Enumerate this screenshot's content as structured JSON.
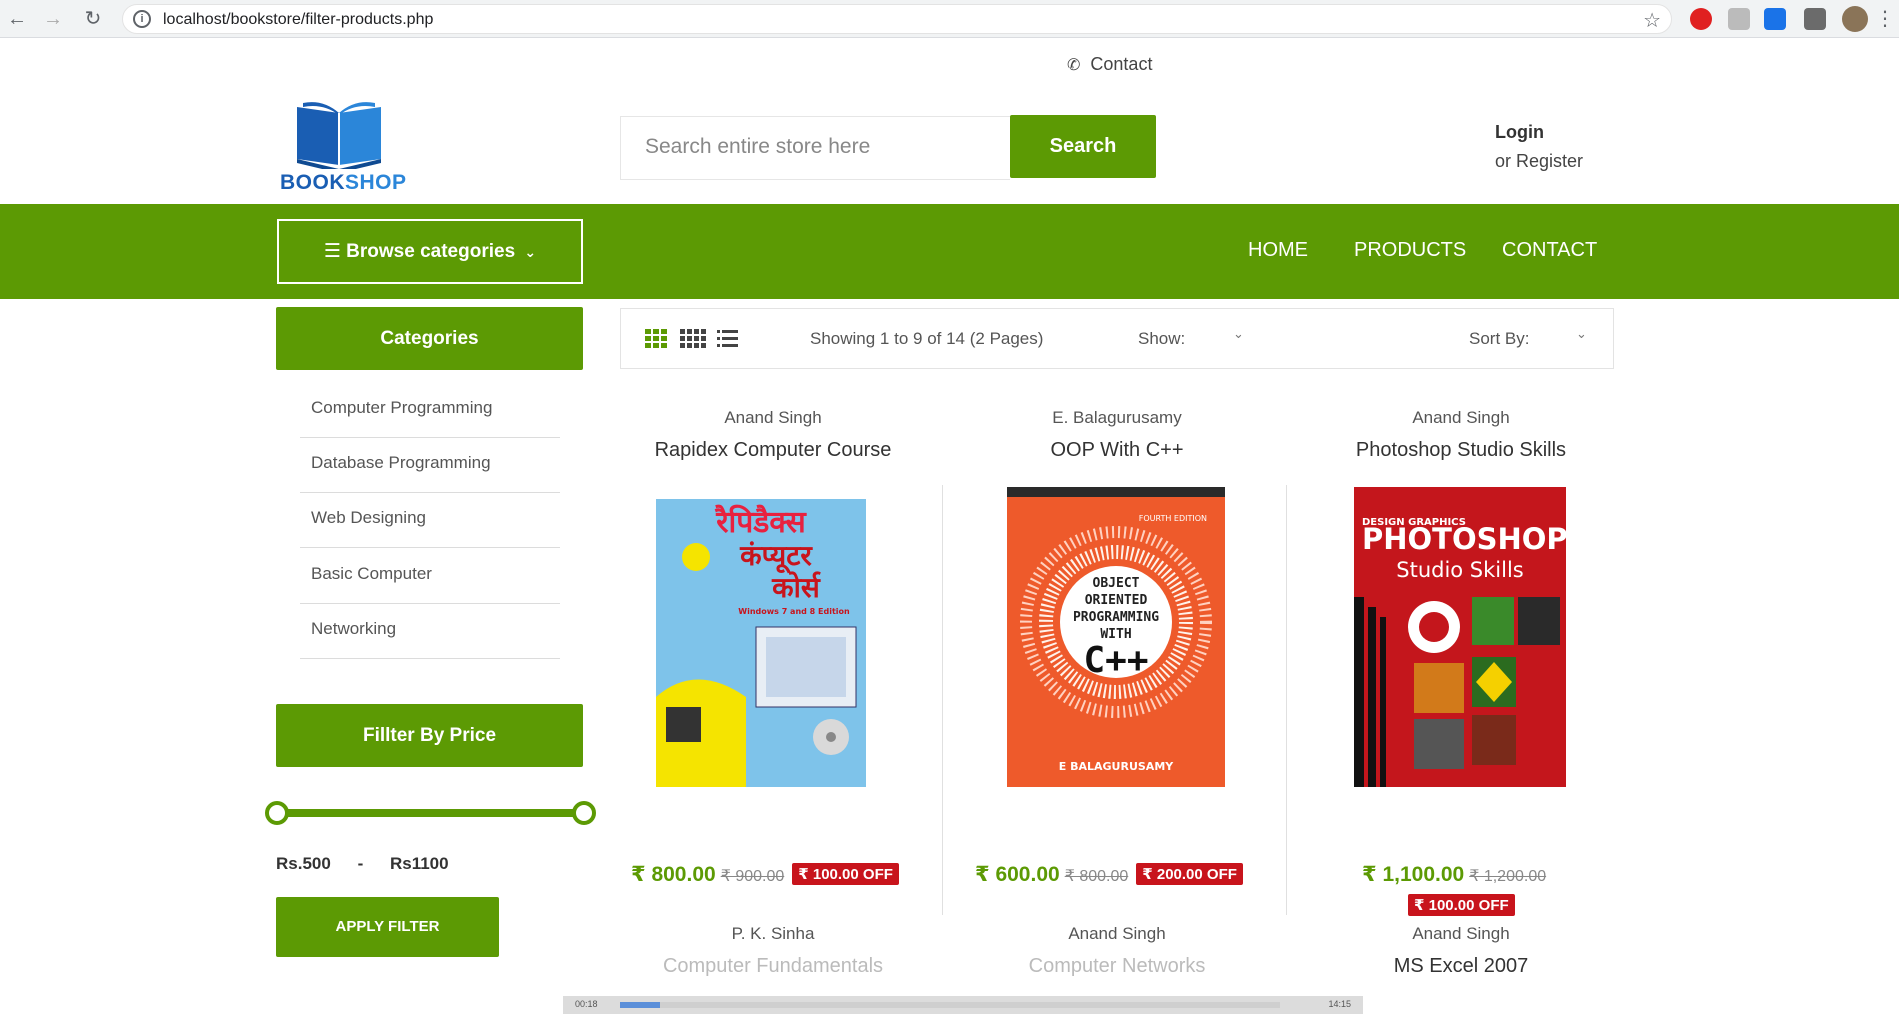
{
  "browser": {
    "url": "localhost/bookstore/filter-products.php"
  },
  "header": {
    "contact_label": "Contact",
    "logo_text_1": "BOOK",
    "logo_text_2": "SHOP",
    "search_placeholder": "Search entire store here",
    "search_button": "Search",
    "login_label": "Login",
    "register_label": "or Register"
  },
  "navbar": {
    "browse_label": "Browse categories",
    "menu": [
      "HOME",
      "PRODUCTS",
      "CONTACT"
    ]
  },
  "sidebar": {
    "categories_title": "Categories",
    "categories": [
      "Computer Programming",
      "Database Programming",
      "Web Designing",
      "Basic Computer",
      "Networking"
    ],
    "filter_title": "Fillter By Price",
    "price_min": "Rs.500",
    "price_sep": "-",
    "price_max": "Rs1100",
    "apply_label": "APPLY FILTER"
  },
  "toolbar": {
    "showing": "Showing 1 to 9 of 14 (2 Pages)",
    "show_label": "Show:",
    "sort_label": "Sort By:"
  },
  "products": [
    {
      "author": "Anand Singh",
      "title": "Rapidex Computer Course",
      "price": "₹ 800.00",
      "old_price": "₹ 900.00",
      "off": "₹ 100.00 OFF"
    },
    {
      "author": "E. Balagurusamy",
      "title": "OOP With C++",
      "price": "₹ 600.00",
      "old_price": "₹ 800.00",
      "off": "₹ 200.00 OFF"
    },
    {
      "author": "Anand Singh",
      "title": "Photoshop Studio Skills",
      "price": "₹ 1,100.00",
      "old_price": "₹ 1,200.00",
      "off": "₹ 100.00 OFF"
    }
  ],
  "products_row2": [
    {
      "author": "P. K. Sinha",
      "title": "Computer Fundamentals"
    },
    {
      "author": "Anand Singh",
      "title": "Computer Networks"
    },
    {
      "author": "Anand Singh",
      "title": "MS Excel 2007"
    }
  ],
  "covers": {
    "c1_top": "रैपिडैक्स",
    "c1_mid": "कंप्यूटर",
    "c1_bot": "कोर्स",
    "c1_ed": "Windows 7 and 8 Edition",
    "c2_lines": [
      "OBJECT",
      "ORIENTED",
      "PROGRAMMING",
      "WITH"
    ],
    "c2_big": "C++",
    "c2_author": "E BALAGURUSAMY",
    "c2_edition": "FOURTH EDITION",
    "c3_brand": "DESIGN GRAPHICS",
    "c3_title": "PHOTOSHOP",
    "c3_sub": "Studio Skills"
  },
  "video": {
    "time_current": "00:18",
    "time_total": "14:15"
  },
  "colors": {
    "brand_green": "#5c9a04",
    "badge_red": "#c8141c"
  }
}
